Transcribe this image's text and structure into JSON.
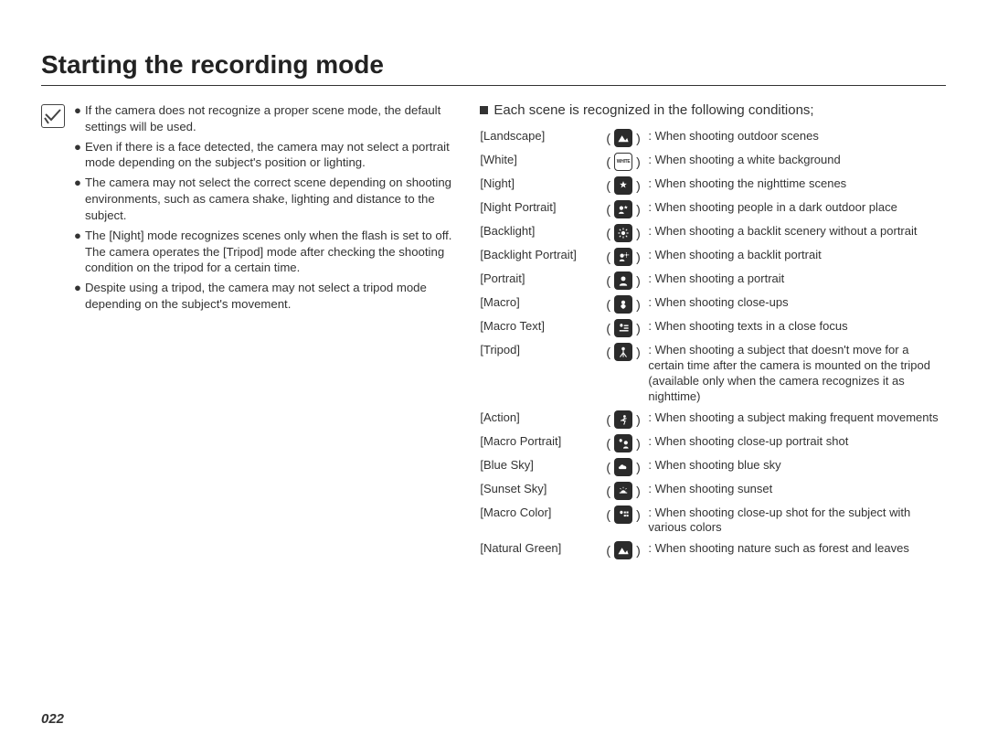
{
  "title": "Starting the recording mode",
  "page_number": "022",
  "note_bullets": [
    "If the camera does not recognize a proper scene mode, the default settings will be used.",
    "Even if there is a face detected, the camera may not select a portrait mode depending on the subject's position or lighting.",
    "The camera may not select the correct scene depending on shooting environments, such as camera shake, lighting and distance to the subject.",
    "The [Night] mode recognizes scenes only when the flash is set to off. The camera operates the [Tripod] mode after checking the shooting condition on the tripod for a certain time.",
    "Despite using a tripod, the camera may not select a tripod mode depending on the subject's movement."
  ],
  "scene_heading": "Each scene is recognized in the following conditions;",
  "scenes": [
    {
      "label": "[Landscape]",
      "icon": "landscape-icon",
      "desc": "When shooting outdoor scenes"
    },
    {
      "label": "[White]",
      "icon": "white-icon",
      "desc": "When shooting a white background"
    },
    {
      "label": "[Night]",
      "icon": "night-icon",
      "desc": "When shooting the nighttime scenes"
    },
    {
      "label": "[Night Portrait]",
      "icon": "night-portrait-icon",
      "desc": "When shooting people in a dark outdoor place"
    },
    {
      "label": "[Backlight]",
      "icon": "backlight-icon",
      "desc": "When shooting a backlit scenery without a portrait"
    },
    {
      "label": "[Backlight Portrait]",
      "icon": "backlight-portrait-icon",
      "desc": "When shooting a backlit portrait"
    },
    {
      "label": "[Portrait]",
      "icon": "portrait-icon",
      "desc": "When shooting a portrait"
    },
    {
      "label": "[Macro]",
      "icon": "macro-icon",
      "desc": "When shooting close-ups"
    },
    {
      "label": "[Macro Text]",
      "icon": "macro-text-icon",
      "desc": "When shooting texts in a close focus"
    },
    {
      "label": "[Tripod]",
      "icon": "tripod-icon",
      "desc": "When shooting a subject that doesn't move for a certain time after the camera is mounted on the tripod (available only when the camera recognizes it as nighttime)"
    },
    {
      "label": "[Action]",
      "icon": "action-icon",
      "desc": "When shooting a subject making frequent movements"
    },
    {
      "label": "[Macro Portrait]",
      "icon": "macro-portrait-icon",
      "desc": "When shooting close-up portrait shot"
    },
    {
      "label": "[Blue Sky]",
      "icon": "blue-sky-icon",
      "desc": "When shooting blue sky"
    },
    {
      "label": "[Sunset Sky]",
      "icon": "sunset-sky-icon",
      "desc": "When shooting sunset"
    },
    {
      "label": "[Macro Color]",
      "icon": "macro-color-icon",
      "desc": "When shooting close-up shot for the subject with various colors"
    },
    {
      "label": "[Natural Green]",
      "icon": "natural-green-icon",
      "desc": "When shooting nature such as forest and leaves"
    }
  ]
}
